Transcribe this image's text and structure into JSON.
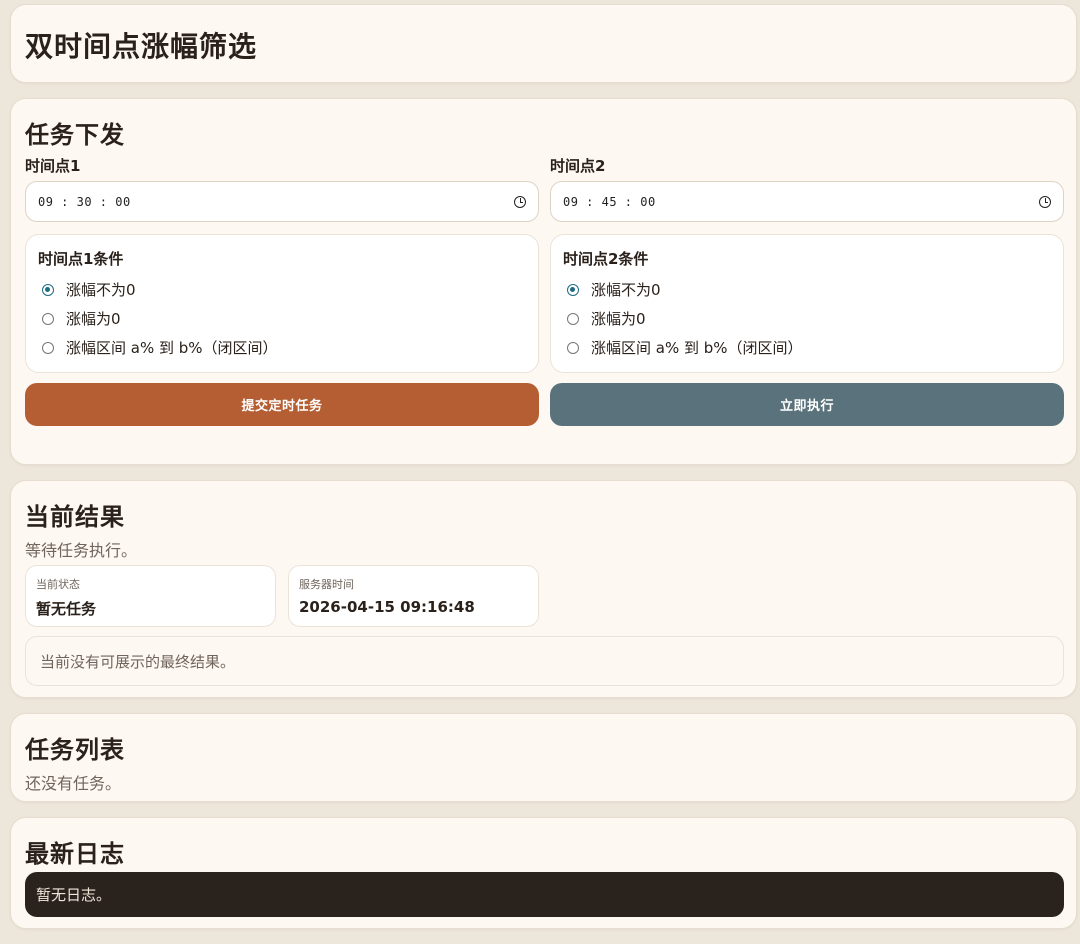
{
  "page_title": "双时间点涨幅筛选",
  "task": {
    "heading": "任务下发",
    "time1_label": "时间点1",
    "time1_value": "09 : 30 : 00",
    "time2_label": "时间点2",
    "time2_value": "09 : 45 : 00",
    "cond1": {
      "title": "时间点1条件",
      "options": [
        "涨幅不为0",
        "涨幅为0",
        "涨幅区间 a% 到 b%（闭区间）"
      ],
      "selected": 0
    },
    "cond2": {
      "title": "时间点2条件",
      "options": [
        "涨幅不为0",
        "涨幅为0",
        "涨幅区间 a% 到 b%（闭区间）"
      ],
      "selected": 0
    },
    "submit_label": "提交定时任务",
    "run_label": "立即执行"
  },
  "result": {
    "heading": "当前结果",
    "status_text": "等待任务执行。",
    "state_label": "当前状态",
    "state_value": "暂无任务",
    "server_time_label": "服务器时间",
    "server_time_value": "2026-04-15 09:16:48",
    "empty_text": "当前没有可展示的最终结果。"
  },
  "task_list": {
    "heading": "任务列表",
    "empty_text": "还没有任务。"
  },
  "logs": {
    "heading": "最新日志",
    "empty_text": "暂无日志。"
  },
  "colors": {
    "submit_button": "#b55e33",
    "run_button": "#5a727c",
    "log_background": "#2a221c",
    "radio_accent": "#1f6b82"
  }
}
